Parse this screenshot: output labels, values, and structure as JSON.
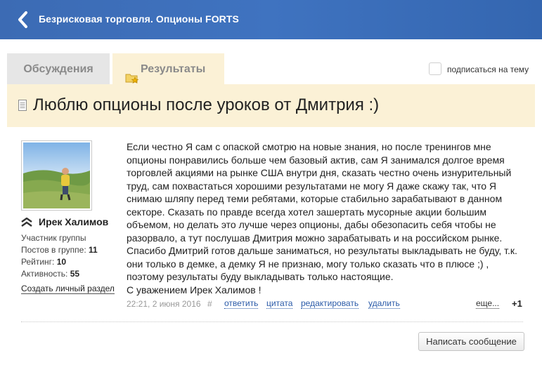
{
  "header": {
    "title": "Безрисковая торговля. Опционы FORTS",
    "back_icon": "chevron-left-icon"
  },
  "tabs": [
    {
      "label": "Обсуждения",
      "active": false
    },
    {
      "label": "Результаты",
      "active": true,
      "icon": "folder-star-icon"
    }
  ],
  "subscribe": {
    "label": "подписаться на тему",
    "checked": false
  },
  "topic": {
    "title": "Люблю опционы после уроков от Дмитрия :)",
    "icon": "document-icon"
  },
  "author": {
    "name": "Ирек Халимов",
    "rank_icon": "rank-chevrons-icon",
    "role": "Участник группы",
    "posts_label": "Постов в группе:",
    "posts": "11",
    "rating_label": "Рейтинг:",
    "rating": "10",
    "activity_label": "Активность:",
    "activity": "55",
    "create_section": "Создать личный раздел"
  },
  "post": {
    "lines": [
      "Если честно Я сам с опаской смотрю на новые знания, но после тренингов мне",
      "опционы понравились больше чем базовый актив, сам Я занимался долгое время",
      "торговлей акциями на рынке США внутри дня, сказать честно очень изнурительный",
      "труд, сам похвастаться хорошими результатами не могу Я даже скажу так, что Я",
      "снимаю шляпу перед теми ребятами, которые стабильно зарабатывают в данном",
      "секторе. Сказать по правде всегда хотел зашертать мусорные акции большим",
      "объемом, но делать это лучше через опционы, дабы обезопасить себя чтобы не",
      "разорвало, а тут послушав Дмитрия можно зарабатывать и на российском рынке.",
      "Спасибо Дмитрий готов дальше заниматься, но результаты выкладывать не буду, т.к.",
      "они только в демке, а демку Я не признаю, могу только сказать что в плюсе ;) ,",
      "поэтому результаты буду выкладывать только настоящие.",
      "С уважением Ирек Халимов !"
    ],
    "date": "22:21, 2 июня 2016",
    "hash": "#",
    "actions": [
      "ответить",
      "цитата",
      "редактировать",
      "удалить"
    ],
    "more": "еще...",
    "plus": "+1"
  },
  "write_button": "Написать сообщение",
  "colors": {
    "header": "#3f73c0",
    "tab_active_bg": "#fbf1d6",
    "link": "#2a5aa8"
  }
}
